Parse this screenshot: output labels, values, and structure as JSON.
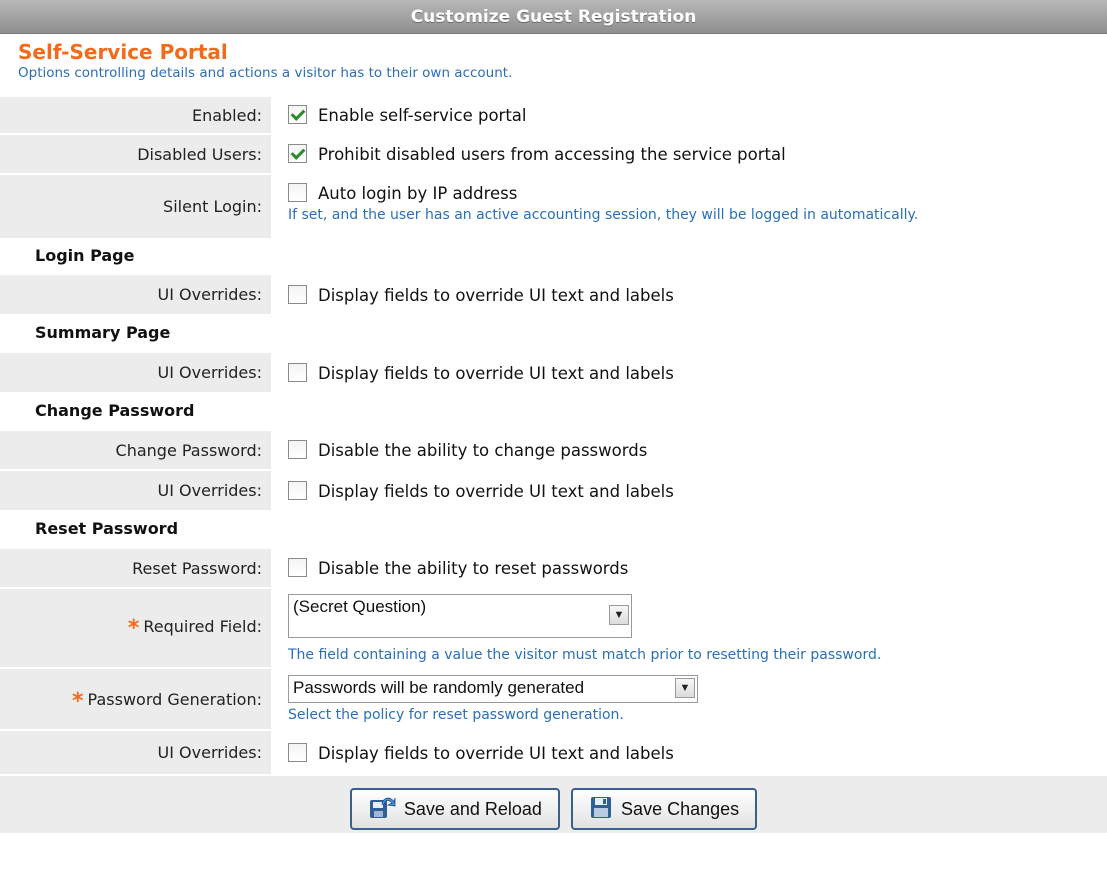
{
  "panel": {
    "title": "Customize Guest Registration"
  },
  "section": {
    "title": "Self-Service Portal",
    "description": "Options controlling details and actions a visitor has to their own account."
  },
  "rows": {
    "enabled": {
      "label": "Enabled:",
      "text": "Enable self-service portal",
      "checked": true
    },
    "disabled_users": {
      "label": "Disabled Users:",
      "text": "Prohibit disabled users from accessing the service portal",
      "checked": true
    },
    "silent_login": {
      "label": "Silent Login:",
      "text": "Auto login by IP address",
      "checked": false,
      "hint": "If set, and the user has an active accounting session, they will be logged in automatically."
    }
  },
  "login_page": {
    "heading": "Login Page",
    "ui_overrides": {
      "label": "UI Overrides:",
      "text": "Display fields to override UI text and labels",
      "checked": false
    }
  },
  "summary_page": {
    "heading": "Summary Page",
    "ui_overrides": {
      "label": "UI Overrides:",
      "text": "Display fields to override UI text and labels",
      "checked": false
    }
  },
  "change_password": {
    "heading": "Change Password",
    "change": {
      "label": "Change Password:",
      "text": "Disable the ability to change passwords",
      "checked": false
    },
    "ui_overrides": {
      "label": "UI Overrides:",
      "text": "Display fields to override UI text and labels",
      "checked": false
    }
  },
  "reset_password": {
    "heading": "Reset Password",
    "reset": {
      "label": "Reset Password:",
      "text": "Disable the ability to reset passwords",
      "checked": false
    },
    "required_field": {
      "required_mark": "*",
      "label": "Required Field:",
      "value": "(Secret Question)",
      "hint": "The field containing a value the visitor must match prior to resetting their password."
    },
    "password_generation": {
      "required_mark": "*",
      "label": "Password Generation:",
      "value": "Passwords will be randomly generated",
      "hint": "Select the policy for reset password generation."
    },
    "ui_overrides": {
      "label": "UI Overrides:",
      "text": "Display fields to override UI text and labels",
      "checked": false
    }
  },
  "buttons": {
    "save_reload": "Save and Reload",
    "save_changes": "Save Changes"
  },
  "icons": {
    "save_reload": "save-reload-icon",
    "save_changes": "floppy-disk-icon",
    "dropdown": "chevron-down-icon"
  }
}
